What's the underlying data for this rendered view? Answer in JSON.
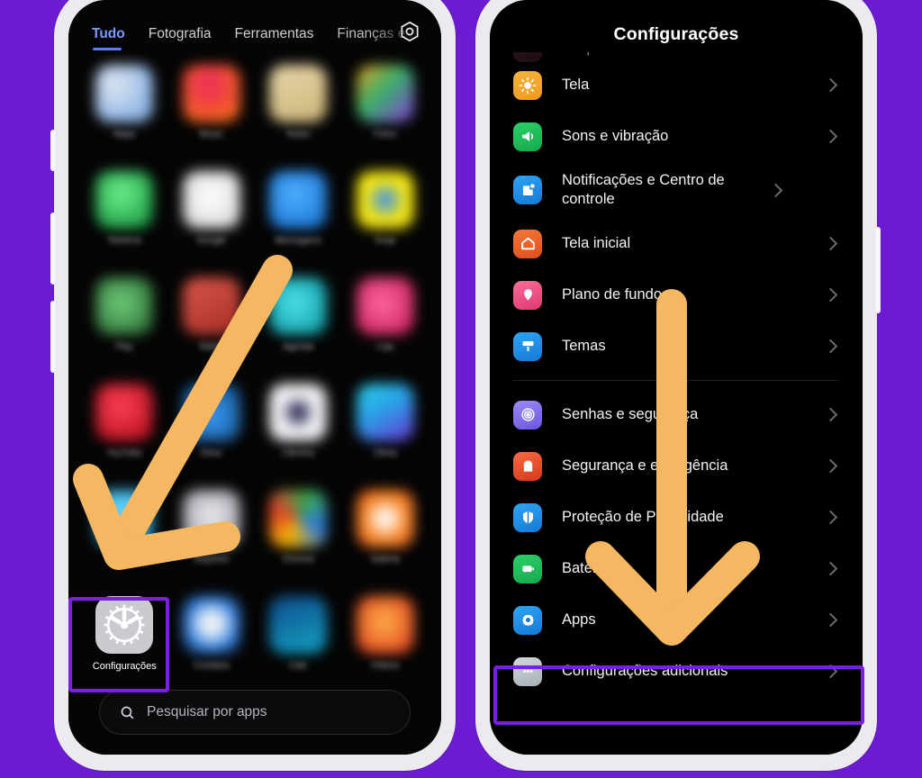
{
  "background_color": "#6B1BD1",
  "accent_highlight_color": "#7B1FE0",
  "arrow_color": "#F5B761",
  "left_phone": {
    "name": "app-drawer-screen",
    "tabs": [
      {
        "label": "Tudo",
        "active": true
      },
      {
        "label": "Fotografia",
        "active": false
      },
      {
        "label": "Ferramentas",
        "active": false
      },
      {
        "label": "Finanças e N",
        "active": false
      }
    ],
    "gear_icon": "hexagon-gear-icon",
    "app_rows": [
      [
        {
          "label": "",
          "color1": "#dfe6ef",
          "color2": "#8fb6e8"
        },
        {
          "label": "",
          "color1": "#f0295f",
          "color2": "#f2641f"
        },
        {
          "label": "",
          "color1": "#e8d6a8",
          "color2": "#cbb municipality"
        },
        {
          "label": "",
          "color1": "#39b06a",
          "color2": "#8c3ae0"
        }
      ],
      [
        {
          "label": "",
          "color1": "#3ddc6e",
          "color2": "#1d9c45"
        },
        {
          "label": "",
          "color1": "#f4f4f6",
          "color2": "#d9dadd"
        },
        {
          "label": "",
          "color1": "#2f97f0",
          "color2": "#1a74d4"
        },
        {
          "label": "",
          "color1": "#f2e515",
          "color2": "#cfc40d"
        }
      ],
      [
        {
          "label": "",
          "color1": "#3c8f47",
          "color2": "#2d6b36"
        },
        {
          "label": "",
          "color1": "#c9463b",
          "color2": "#a62f27"
        },
        {
          "label": "",
          "color1": "#15bcc6",
          "color2": "#0e9aa3"
        },
        {
          "label": "",
          "color1": "#f23d7a",
          "color2": "#c91f5c"
        }
      ],
      [
        {
          "label": "",
          "color1": "#e0162c",
          "color2": "#b2101f"
        },
        {
          "label": "",
          "color1": "#1e7fe8",
          "color2": "#1560b8"
        },
        {
          "label": "",
          "color1": "#e9e9ee",
          "color2": "#9a9aa6"
        },
        {
          "label": "",
          "color1": "#2aa0e8",
          "color2": "#6a32d6"
        }
      ],
      [
        {
          "label": "",
          "color1": "#35c2f0",
          "color2": "#1f8fc4"
        },
        {
          "label": "",
          "color1": "#cfcfd6",
          "color2": "#9c9ca6"
        },
        {
          "label": "",
          "color1": "#f2b705",
          "color2": "#3aa64a"
        },
        {
          "label": "",
          "color1": "#f58220",
          "color2": "#e0552a"
        }
      ]
    ],
    "highlighted_app": {
      "label": "Configurações",
      "icon": "gear-icon",
      "icon_bg": "#C9CBD0"
    },
    "bottom_row_blurred": [
      {
        "color1": "#d8dde5",
        "color2": "#3b7fe0"
      },
      {
        "color1": "#0f4a8a",
        "color2": "#12a3c4"
      },
      {
        "color1": "#f58220",
        "color2": "#e0401f"
      }
    ],
    "search": {
      "icon": "search-icon",
      "placeholder": "Pesquisar por apps"
    }
  },
  "right_phone": {
    "name": "settings-screen",
    "title": "Configurações",
    "cut_off_item": "bloqueio",
    "groups": [
      {
        "items": [
          {
            "label": "Tela",
            "icon": "brightness-icon",
            "color1": "#F6B43C",
            "color2": "#EE9A1E"
          },
          {
            "label": "Sons e vibração",
            "icon": "speaker-icon",
            "color1": "#21C45D",
            "color2": "#17A84B"
          },
          {
            "label": "Notificações e Centro de controle",
            "icon": "notification-icon",
            "color1": "#2A9BF0",
            "color2": "#1579D4",
            "two_line": true
          },
          {
            "label": "Tela inicial",
            "icon": "home-icon",
            "color1": "#F26B2E",
            "color2": "#DE4E1C"
          },
          {
            "label": "Plano de fundo",
            "icon": "wallpaper-icon",
            "color1": "#F45C8C",
            "color2": "#E03A70"
          },
          {
            "label": "Temas",
            "icon": "theme-brush-icon",
            "color1": "#2A9BF0",
            "color2": "#1579D4"
          }
        ]
      },
      {
        "items": [
          {
            "label": "Senhas e segurança",
            "icon": "fingerprint-icon",
            "color1": "#8E7CF0",
            "color2": "#6B55E0"
          },
          {
            "label": "Segurança e emergência",
            "icon": "emergency-icon",
            "color1": "#F2552E",
            "color2": "#D8381A"
          },
          {
            "label": "Proteção de Privacidade",
            "icon": "privacy-shield-icon",
            "color1": "#2A9BF0",
            "color2": "#1579D4"
          },
          {
            "label": "Bateria",
            "icon": "battery-icon",
            "color1": "#21C45D",
            "color2": "#17A84B"
          },
          {
            "label": "Apps",
            "icon": "apps-gear-icon",
            "color1": "#2A9BF0",
            "color2": "#1579D4",
            "highlighted": true
          },
          {
            "label": "Configurações adicionais",
            "icon": "more-dots-icon",
            "color1": "#C7CDD4",
            "color2": "#A8B0B8"
          }
        ]
      }
    ]
  },
  "annotations": {
    "left_arrow": "down-left-arrow",
    "right_arrow": "down-arrow"
  }
}
